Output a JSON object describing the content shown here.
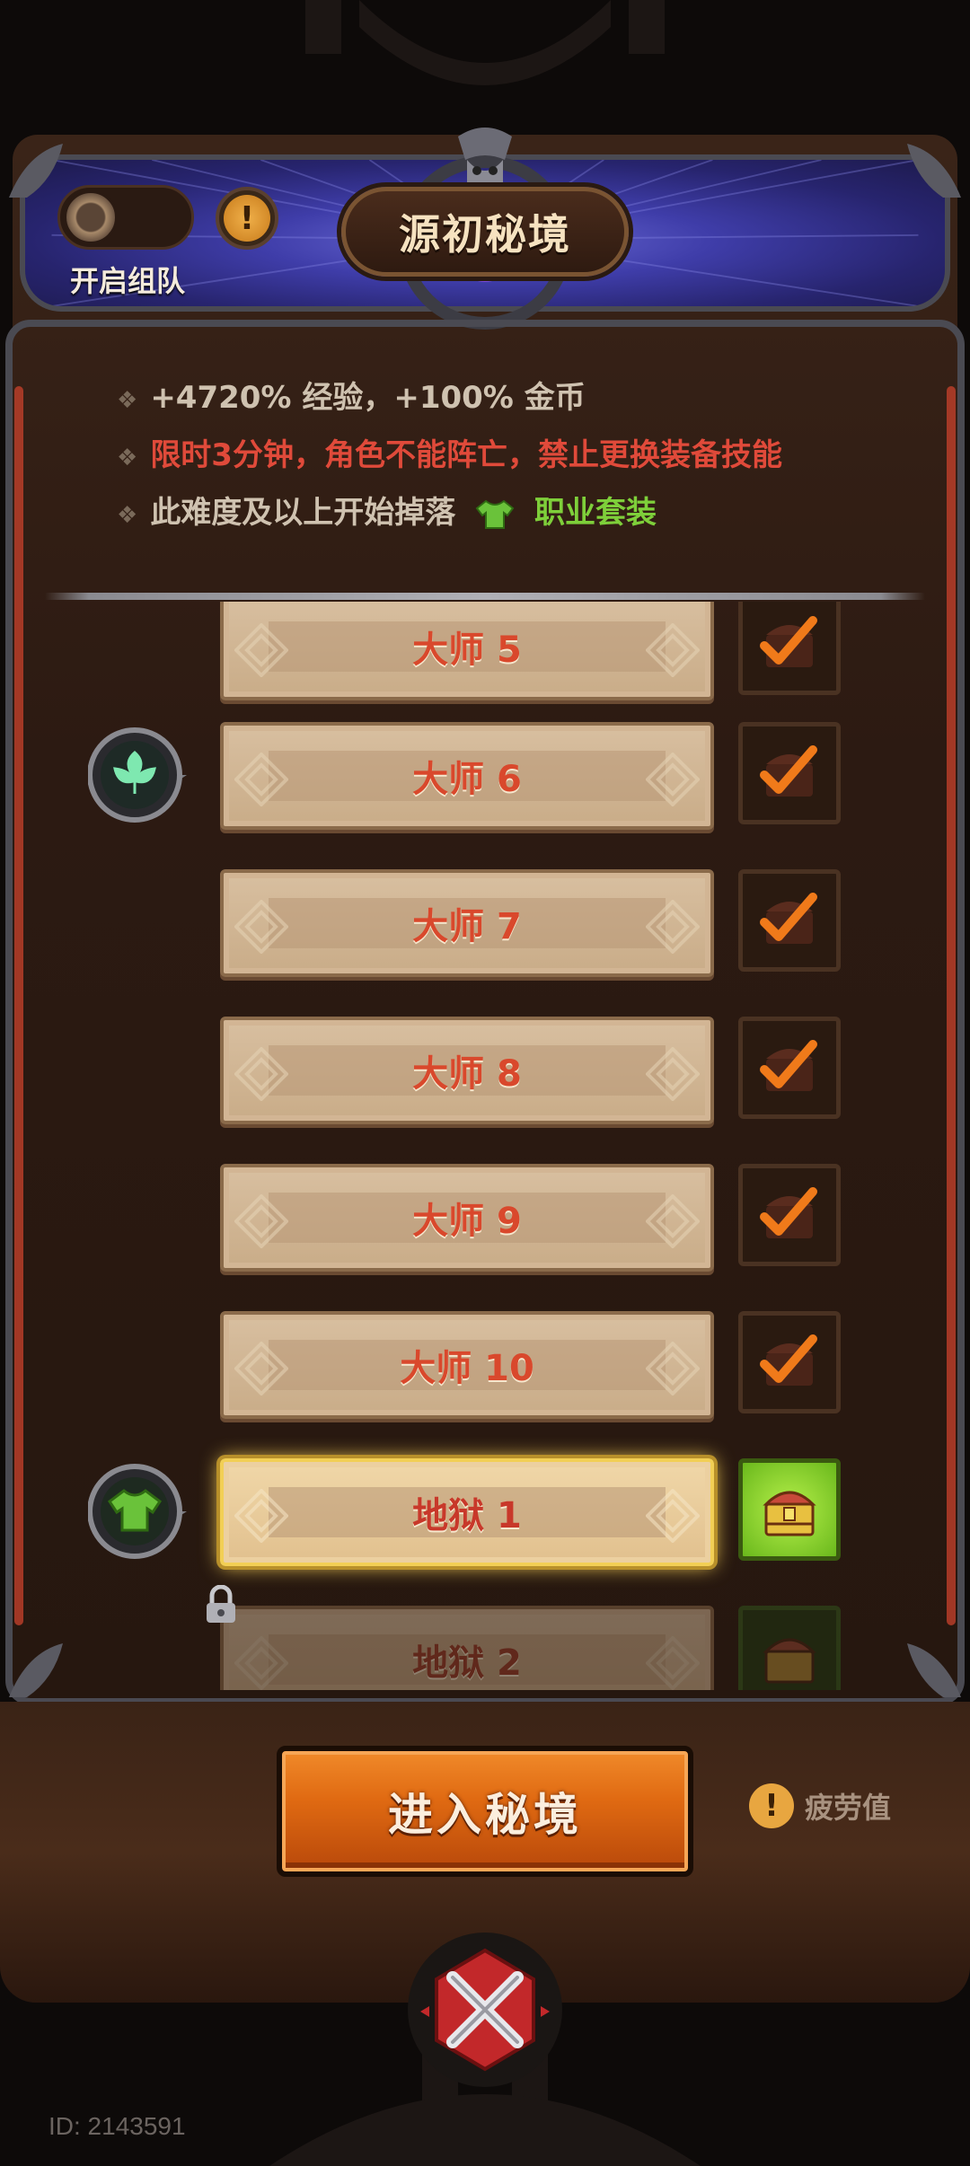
{
  "header": {
    "title": "源初秘境",
    "team_toggle_label": "开启组队",
    "team_toggle_on": false,
    "info_icon": "exclamation-icon"
  },
  "info": {
    "line1": "+4720% 经验，+100% 金币",
    "line2": "限时3分钟，角色不能阵亡，禁止更换装备技能",
    "line3_prefix": "此难度及以上开始掉落",
    "line3_item": "职业套装",
    "colors": {
      "normal": "#cfc2b0",
      "warning": "#e04a3a",
      "highlight": "#7ecf3a"
    }
  },
  "difficulty_list": [
    {
      "label": "大师 5",
      "state": "completed",
      "badge": null
    },
    {
      "label": "大师 6",
      "state": "completed",
      "badge": "leaf-icon"
    },
    {
      "label": "大师 7",
      "state": "completed",
      "badge": null
    },
    {
      "label": "大师 8",
      "state": "completed",
      "badge": null
    },
    {
      "label": "大师 9",
      "state": "completed",
      "badge": null
    },
    {
      "label": "大师 10",
      "state": "completed",
      "badge": null
    },
    {
      "label": "地狱 1",
      "state": "selected",
      "badge": "armor-icon"
    },
    {
      "label": "地狱 2",
      "state": "locked",
      "badge": null
    }
  ],
  "actions": {
    "enter_label": "进入秘境",
    "fatigue_label": "疲劳值"
  },
  "footer": {
    "user_id": "ID: 2143591"
  },
  "accent_colors": {
    "enter_button": "#e06a12",
    "selected_glow": "#ffd85a",
    "chest_active": "#8ad42a"
  }
}
